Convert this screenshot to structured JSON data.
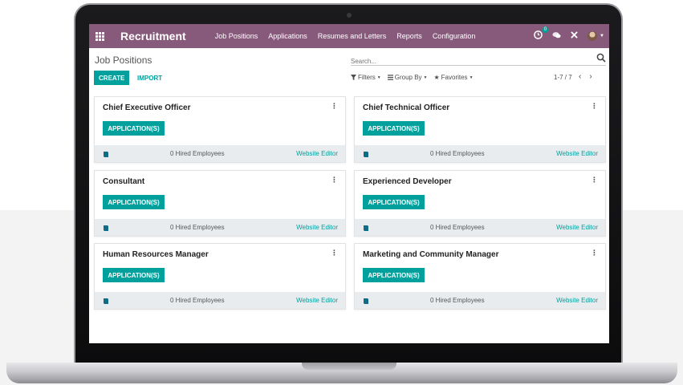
{
  "app": {
    "title": "Recruitment",
    "menu": [
      "Job Positions",
      "Applications",
      "Resumes and Letters",
      "Reports",
      "Configuration"
    ],
    "badge": "0"
  },
  "control_panel": {
    "breadcrumb": "Job Positions",
    "search_placeholder": "Search...",
    "create_label": "CREATE",
    "import_label": "IMPORT",
    "filters_label": "Filters",
    "groupby_label": "Group By",
    "favorites_label": "Favorites",
    "pager": "1-7 / 7"
  },
  "cards": [
    {
      "title": "Chief Executive Officer",
      "button": "APPLICATION(S)",
      "hired": "0 Hired Employees",
      "link": "Website Editor"
    },
    {
      "title": "Chief Technical Officer",
      "button": "APPLICATION(S)",
      "hired": "0 Hired Employees",
      "link": "Website Editor"
    },
    {
      "title": "Consultant",
      "button": "APPLICATION(S)",
      "hired": "0 Hired Employees",
      "link": "Website Editor"
    },
    {
      "title": "Experienced Developer",
      "button": "APPLICATION(S)",
      "hired": "0 Hired Employees",
      "link": "Website Editor"
    },
    {
      "title": "Human Resources Manager",
      "button": "APPLICATION(S)",
      "hired": "0 Hired Employees",
      "link": "Website Editor"
    },
    {
      "title": "Marketing and Community Manager",
      "button": "APPLICATION(S)",
      "hired": "0 Hired Employees",
      "link": "Website Editor"
    }
  ],
  "colors": {
    "brand": "#875a7b",
    "accent": "#00a09d",
    "footer": "#e9ecef"
  },
  "icons": {
    "apps": "apps-grid-icon",
    "search": "search-icon",
    "activity": "clock-icon",
    "chat": "chat-icon",
    "close": "close-icon",
    "footer": "book-icon"
  }
}
